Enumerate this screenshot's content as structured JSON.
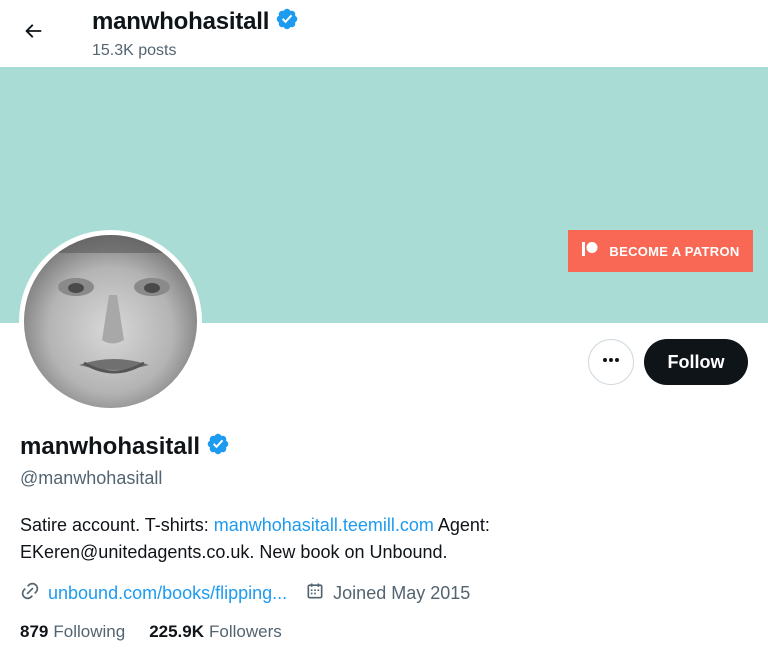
{
  "header": {
    "back_icon": "arrow-left-icon",
    "name": "manwhohasitall",
    "posts_count": "15.3K posts"
  },
  "banner": {
    "background_color": "#a8dcd4",
    "patron_button_label": "BECOME A PATRON",
    "patron_button_color": "#f96854"
  },
  "profile": {
    "display_name": "manwhohasitall",
    "handle": "@manwhohasitall",
    "verified_icon": "verified-badge-icon",
    "bio_before_link": "Satire account. T-shirts: ",
    "bio_link": "manwhohasitall.teemill.com",
    "bio_after_link": " Agent: EKeren@unitedagents.co.uk. New book on Unbound.",
    "website": "unbound.com/books/flipping...",
    "joined": "Joined May 2015",
    "following_count": "879",
    "following_label": "Following",
    "followers_count": "225.9K",
    "followers_label": "Followers"
  },
  "actions": {
    "more_icon": "more-dots-icon",
    "follow_label": "Follow"
  },
  "colors": {
    "accent": "#1d9bf0",
    "primary_text": "#0f1419",
    "secondary_text": "#536471"
  }
}
